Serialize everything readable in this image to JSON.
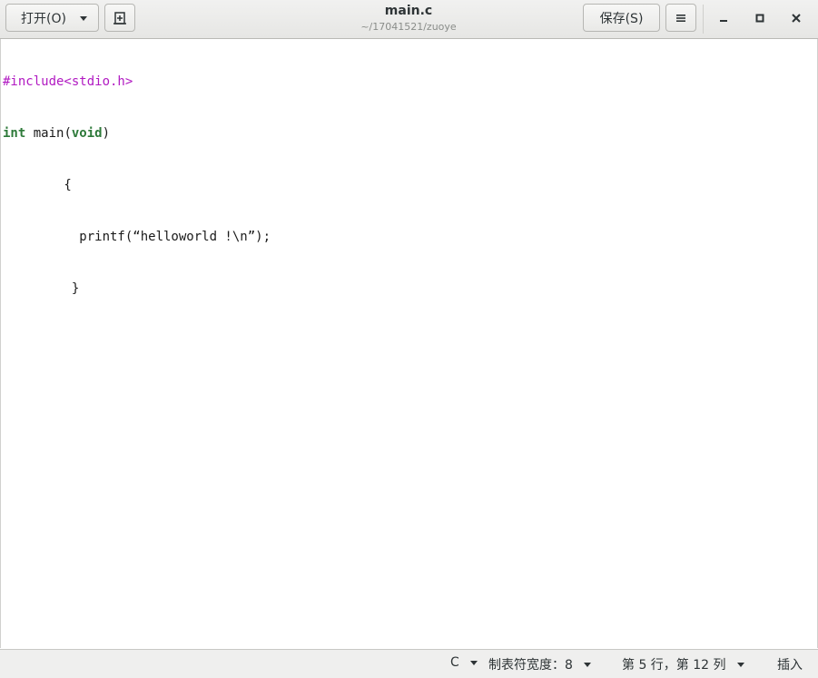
{
  "header": {
    "open_label": "打开(O)",
    "title": "main.c",
    "subtitle": "~/17041521/zuoye",
    "save_label": "保存(S)",
    "menu_icon": "hamburger-icon",
    "new_doc_icon": "new-document-icon",
    "minimize_glyph": "‒",
    "maximize_glyph": "◻",
    "close_glyph": "✕"
  },
  "editor": {
    "lines": [
      {
        "pre": "#include<stdio.h>",
        "mid": "",
        "post": ""
      },
      {
        "pre": "int",
        "mid": " main(",
        "kw2": "void",
        "post": ")"
      },
      {
        "text": "        {"
      },
      {
        "text": "          printf(“helloworld !\\n”);"
      },
      {
        "text": "         }"
      }
    ]
  },
  "statusbar": {
    "language": "C",
    "tab_width": "制表符宽度：8",
    "position": "第 5 行，第 12 列",
    "mode": "插入"
  },
  "colors": {
    "preprocessor": "#b11ac2",
    "keyword": "#2e7a3a"
  }
}
